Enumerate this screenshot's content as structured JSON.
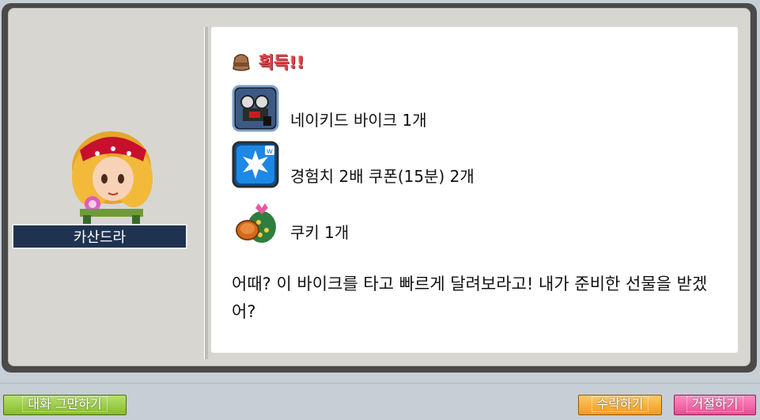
{
  "npc": {
    "name": "카산드라"
  },
  "reward": {
    "title": "획득!!",
    "items": [
      {
        "icon": "naked-bike-icon",
        "label": "네이키드 바이크 1개"
      },
      {
        "icon": "exp-coupon-icon",
        "label": "경험치 2배 쿠폰(15분) 2개"
      },
      {
        "icon": "cookie-bag-icon",
        "label": "쿠키 1개"
      }
    ]
  },
  "dialog": {
    "text": "어때? 이 바이크를 타고 빠르게 달려보라고! 내가 준비한 선물을 받겠어?"
  },
  "buttons": {
    "end_chat": "대화 그만하기",
    "accept": "수락하기",
    "decline": "거절하기"
  },
  "colors": {
    "title_red": "#e0434a",
    "name_plate": "#1f3351",
    "end_button": "#9acb45",
    "accept_button": "#f5a93a",
    "decline_button": "#f06aa8"
  }
}
